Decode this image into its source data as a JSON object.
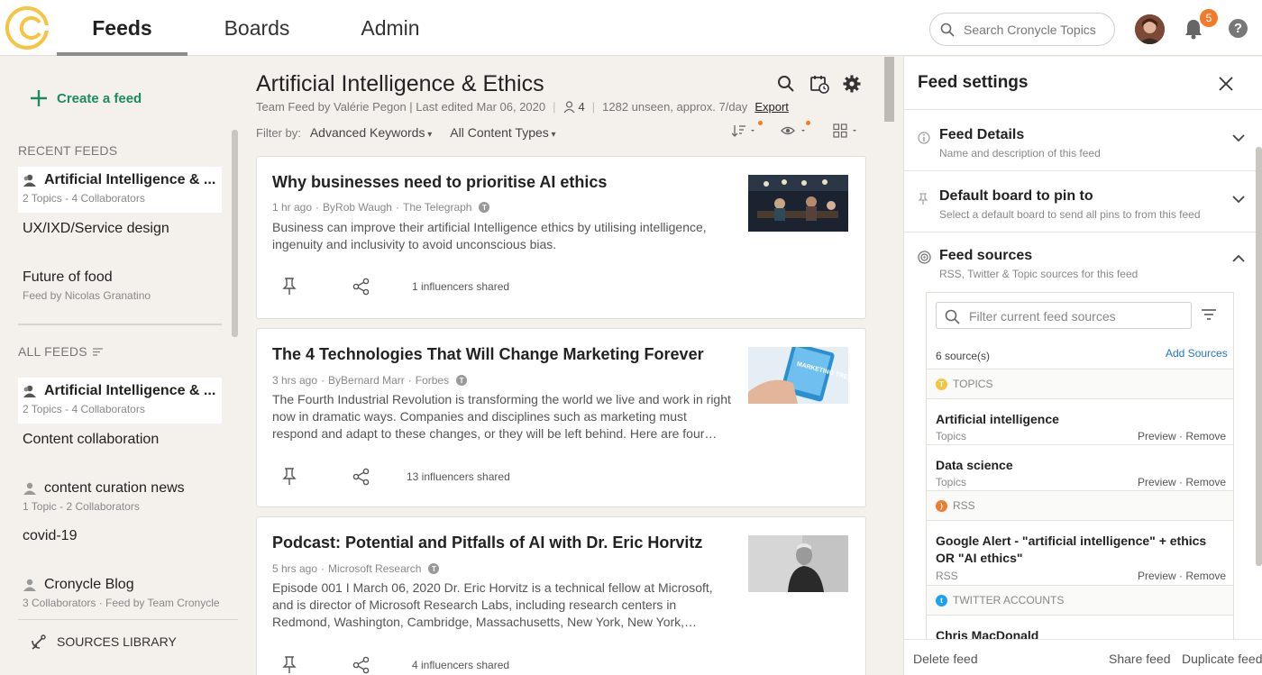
{
  "nav": {
    "tabs": [
      {
        "label": "Feeds",
        "active": true
      },
      {
        "label": "Boards",
        "active": false
      },
      {
        "label": "Admin",
        "active": false
      }
    ],
    "search_placeholder": "Search Cronycle Topics",
    "notification_count": "5",
    "help_label": "?"
  },
  "colors": {
    "accent": "#1f8a60",
    "brand": "#f5c542",
    "badge": "#f07b2c",
    "link": "#2474c8"
  },
  "sidebar": {
    "create_feed": "Create a feed",
    "recent_heading": "RECENT FEEDS",
    "recent": [
      {
        "title": "Artificial Intelligence & ...",
        "sub": "2 Topics - 4 Collaborators",
        "team": true,
        "selected": true
      },
      {
        "title": "UX/IXD/Service design",
        "sub": "",
        "team": false
      },
      {
        "title": "Future of food",
        "sub": "Feed by Nicolas Granatino",
        "team": false
      }
    ],
    "all_heading": "ALL FEEDS",
    "all": [
      {
        "title": "Artificial Intelligence & ...",
        "sub": "2 Topics - 4 Collaborators",
        "team": true,
        "selected": true
      },
      {
        "title": "Content collaboration",
        "sub": "",
        "team": false
      },
      {
        "title": "content curation news",
        "sub": "1 Topic - 2 Collaborators",
        "team": true
      },
      {
        "title": "covid-19",
        "sub": "",
        "team": false
      },
      {
        "title": "Cronycle Blog",
        "sub": "3 Collaborators · Feed by Team Cronycle",
        "team": true
      }
    ],
    "sources_library": "SOURCES LIBRARY"
  },
  "main": {
    "title": "Artificial Intelligence & Ethics",
    "meta_by": "Team Feed by Valérie Pegon | Last edited Mar 06, 2020",
    "collaborators": "4",
    "unseen": "1282 unseen, approx. 7/day",
    "export": "Export",
    "filter_label": "Filter by:",
    "filter_keywords": "Advanced Keywords",
    "filter_content": "All Content Types",
    "articles": [
      {
        "title": "Why businesses need to prioritise AI ethics",
        "time": "1 hr ago",
        "author": "ByRob Waugh",
        "source": "The Telegraph",
        "body": "Business can improve their artificial Intelligence ethics by utilising intelligence, ingenuity and inclusivity to avoid unconscious bias.",
        "influencers": "1 influencers shared",
        "thumb": "office-meeting"
      },
      {
        "title": "The 4 Technologies That Will Change Marketing Forever",
        "time": "3 hrs ago",
        "author": "ByBernard Marr",
        "source": "Forbes",
        "body": "The Fourth Industrial Revolution is transforming the world we live and work in right now in dramatic ways. Companies and disciplines such as marketing must respond and adapt to these changes, or they will be left behind. Here are four technologies that will change marketing forever.",
        "influencers": "13 influencers shared",
        "thumb": "marketing-trends",
        "thumb_text": "MARKETING TRENDS"
      },
      {
        "title": "Podcast: Potential and Pitfalls of AI with Dr. Eric Horvitz",
        "time": "5 hrs ago",
        "author": "",
        "source": "Microsoft Research",
        "body": "Episode 001 I March 06, 2020 Dr. Eric Horvitz is a technical fellow at Microsoft, and is director of Microsoft Research Labs, including research centers in Redmond, Washington, Cambridge, Massachusetts, New York, New York, Montreal, Canada, Cambridge, UK, and Bangalore, India.",
        "influencers": "4 influencers shared",
        "thumb": "portrait"
      }
    ]
  },
  "panel": {
    "title": "Feed settings",
    "sections": [
      {
        "title": "Feed Details",
        "sub": "Name and description of this feed",
        "icon": "info-icon"
      },
      {
        "title": "Default board to pin to",
        "sub": "Select a default board to send all pins to from this feed",
        "icon": "pin-icon"
      },
      {
        "title": "Feed sources",
        "sub": "RSS, Twitter & Topic sources for this feed",
        "icon": "target-icon"
      }
    ],
    "filter_placeholder": "Filter current feed sources",
    "source_count": "6 source(s)",
    "add_sources": "Add Sources",
    "groups": {
      "topics": "TOPICS",
      "rss": "RSS",
      "twitter": "TWITTER ACCOUNTS"
    },
    "sources": [
      {
        "name": "Artificial intelligence",
        "type": "Topics"
      },
      {
        "name": "Data science",
        "type": "Topics"
      },
      {
        "name": "Google Alert - \"artificial intelligence\" + ethics OR \"AI ethics\"",
        "type": "RSS"
      },
      {
        "name": "Chris MacDonald",
        "type": "Twitter"
      }
    ],
    "preview": "Preview",
    "remove": "Remove",
    "link_sep": "·",
    "footer": {
      "delete": "Delete feed",
      "share": "Share feed",
      "duplicate": "Duplicate feed"
    }
  }
}
